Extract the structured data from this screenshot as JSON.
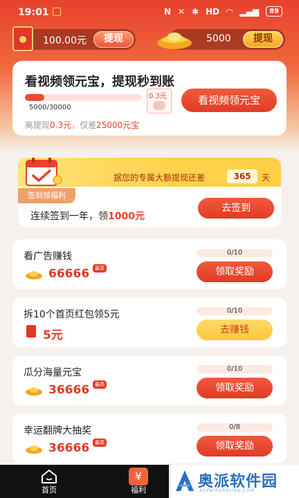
{
  "status": {
    "time": "19:01",
    "network": "HD",
    "battery": "89"
  },
  "balance": {
    "cash": "100.00元",
    "cash_btn": "提现",
    "ingots": "5000",
    "ingot_btn": "提现"
  },
  "video_card": {
    "title": "看视频领元宝，提现秒到账",
    "progress_text": "5000/30000",
    "progress_ratio": 0.1667,
    "reward_amount": "0.3元",
    "cta": "看视频领元宝",
    "hint_prefix": "离提现",
    "hint_amount": "0.3元",
    "hint_mid": "，仅差",
    "hint_ingots": "25000元宝"
  },
  "sign_in": {
    "banner_text": "据您的专属大额提现还差",
    "days": "365",
    "days_unit": "天",
    "tag": "签到领福利",
    "desc_prefix": "连续签到一年，领",
    "desc_amount": "1000元",
    "cta": "去签到"
  },
  "tasks": [
    {
      "title": "看广告赚钱",
      "reward": "66666",
      "reward_type": "ingot",
      "max_label": "最高",
      "progress": "0/10",
      "cta": "领取奖励",
      "cta_style": "red"
    },
    {
      "title": "拆10个首页红包领5元",
      "reward": "5元",
      "reward_type": "redpack",
      "max_label": "",
      "progress": "0/10",
      "cta": "去赚钱",
      "cta_style": "yellow"
    },
    {
      "title": "瓜分海量元宝",
      "reward": "36666",
      "reward_type": "ingot",
      "max_label": "最高",
      "progress": "0/10",
      "cta": "领取奖励",
      "cta_style": "red"
    },
    {
      "title": "幸运翻牌大抽奖",
      "reward": "36666",
      "reward_type": "ingot",
      "max_label": "最高",
      "progress": "0/8",
      "cta": "领取奖励",
      "cta_style": "red"
    }
  ],
  "nav": {
    "home": "首页",
    "welfare": "福利",
    "welfare_glyph": "¥"
  },
  "watermark": {
    "text": "奥派软件园",
    "sub": "AOPAIRUANJIAN.COM"
  },
  "colors": {
    "brand_red": "#e23b26",
    "gold": "#ffc63c"
  }
}
